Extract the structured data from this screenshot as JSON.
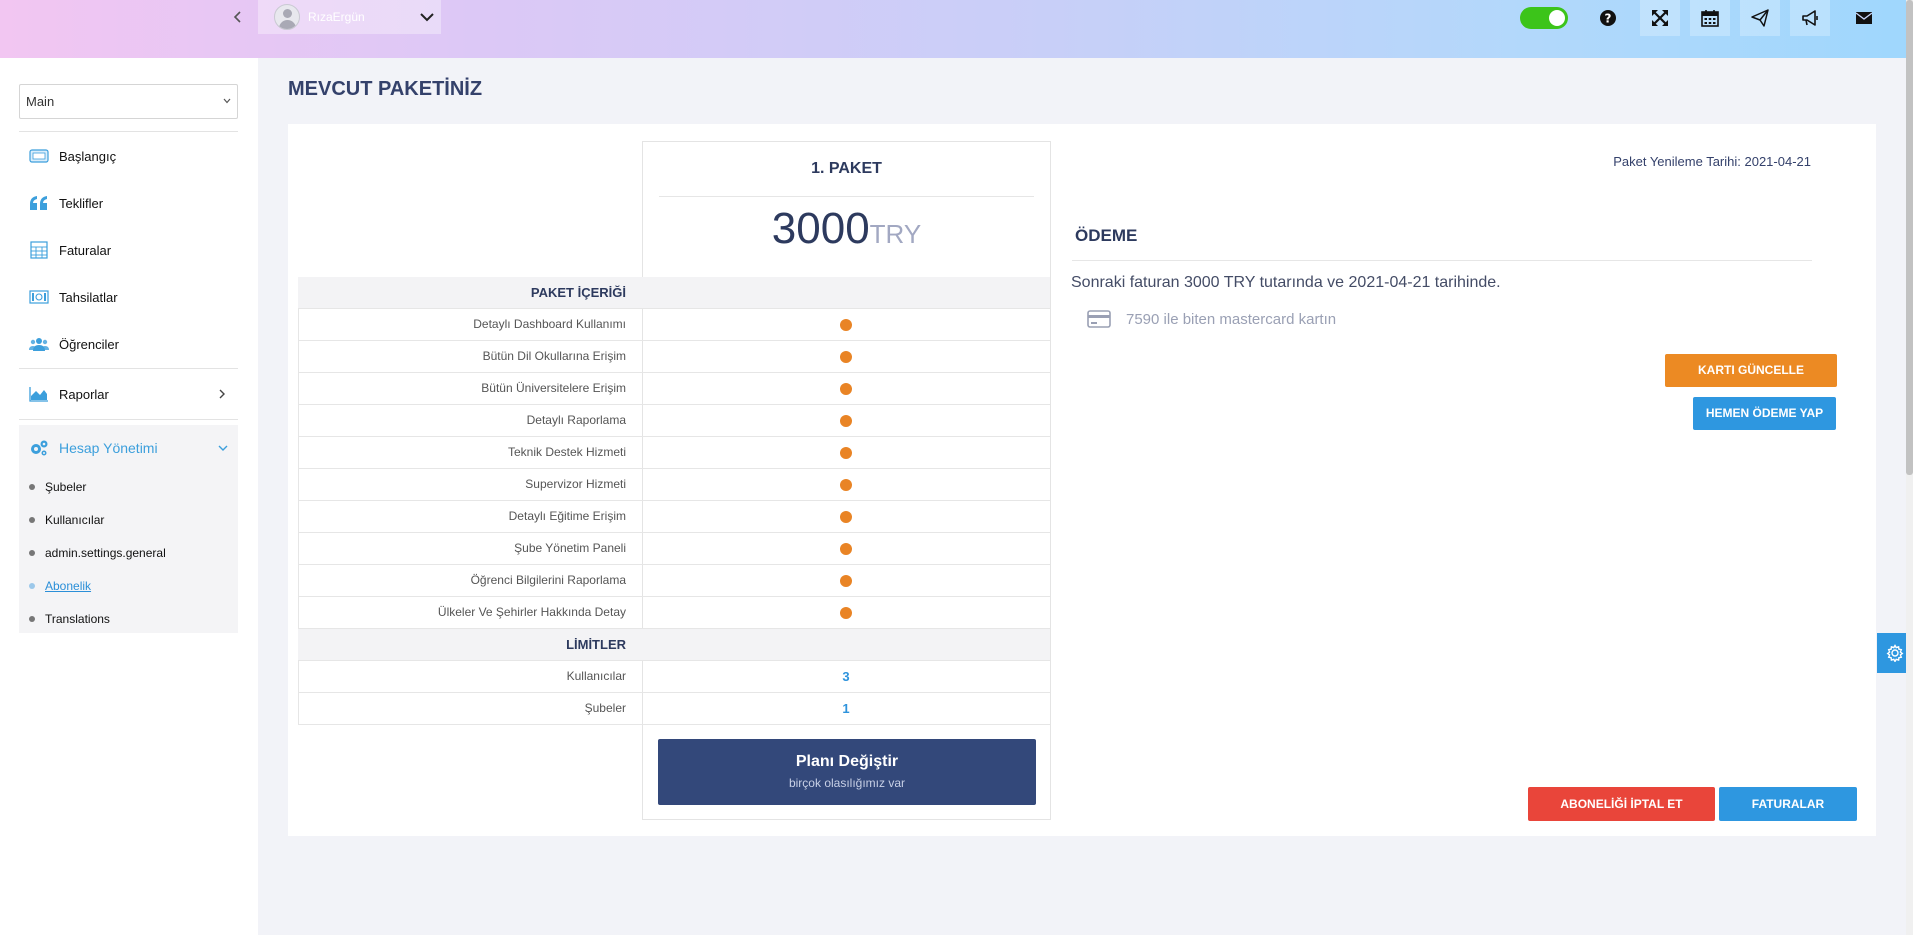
{
  "topbar": {
    "collapse_icon": "chevron-left",
    "user_name": "RızaErgün",
    "user_chevron": "chevron-down",
    "toggle_on": true,
    "icons": [
      "help-icon",
      "fullscreen-icon",
      "calendar-icon",
      "send-icon",
      "megaphone-icon",
      "mail-icon"
    ]
  },
  "sidebar": {
    "module_select": "Main",
    "items": [
      {
        "label": "Başlangıç",
        "icon": "dashboard-icon"
      },
      {
        "label": "Teklifler",
        "icon": "quote-icon"
      },
      {
        "label": "Faturalar",
        "icon": "calculator-icon"
      },
      {
        "label": "Tahsilatlar",
        "icon": "money-icon"
      },
      {
        "label": "Öğrenciler",
        "icon": "users-icon"
      },
      {
        "label": "Raporlar",
        "icon": "chart-icon"
      }
    ],
    "group": {
      "label": "Hesap Yönetimi",
      "icon": "gears-icon",
      "sub_items": [
        {
          "label": "Şubeler"
        },
        {
          "label": "Kullanıcılar"
        },
        {
          "label": "admin.settings.general"
        },
        {
          "label": "Abonelik"
        },
        {
          "label": "Translations"
        }
      ]
    }
  },
  "main": {
    "page_title": "MEVCUT PAKETİNİZ",
    "package": {
      "name": "1. PAKET",
      "price": "3000",
      "currency": "TRY"
    },
    "features_header": "PAKET İÇERİĞİ",
    "features": [
      "Detaylı Dashboard Kullanımı",
      "Bütün Dil Okullarına Erişim",
      "Bütün Üniversitelere Erişim",
      "Detaylı Raporlama",
      "Teknik Destek Hizmeti",
      "Supervizor Hizmeti",
      "Detaylı Eğitime Erişim",
      "Şube Yönetim Paneli",
      "Öğrenci Bilgilerini Raporlama",
      "Ülkeler Ve Şehirler Hakkında Detay"
    ],
    "limits_header": "LİMİTLER",
    "limits": [
      {
        "label": "Kullanıcılar",
        "value": "3"
      },
      {
        "label": "Şubeler",
        "value": "1"
      }
    ],
    "change_plan": {
      "title": "Planı Değiştir",
      "subtitle": "birçok olasılığımız var"
    },
    "renewal_text": "Paket Yenileme Tarihi: 2021-04-21",
    "payment": {
      "title": "ÖDEME",
      "next_invoice_text": "Sonraki faturan 3000 TRY tutarında ve 2021-04-21 tarihinde.",
      "card_text": "7590 ile biten mastercard kartın",
      "card_icon": "credit-card-icon",
      "update_card_label": "KARTI GÜNCELLE",
      "pay_now_label": "HEMEN ÖDEME YAP"
    },
    "cancel_label": "ABONELİĞİ İPTAL ET",
    "invoices_label": "FATURALAR"
  },
  "colors": {
    "accent_blue": "#2e97e0",
    "orange": "#ec8a23",
    "red": "#e9453a",
    "navy": "#33487a",
    "feature_dot": "#e98425",
    "toggle_green": "#3cc41a"
  }
}
